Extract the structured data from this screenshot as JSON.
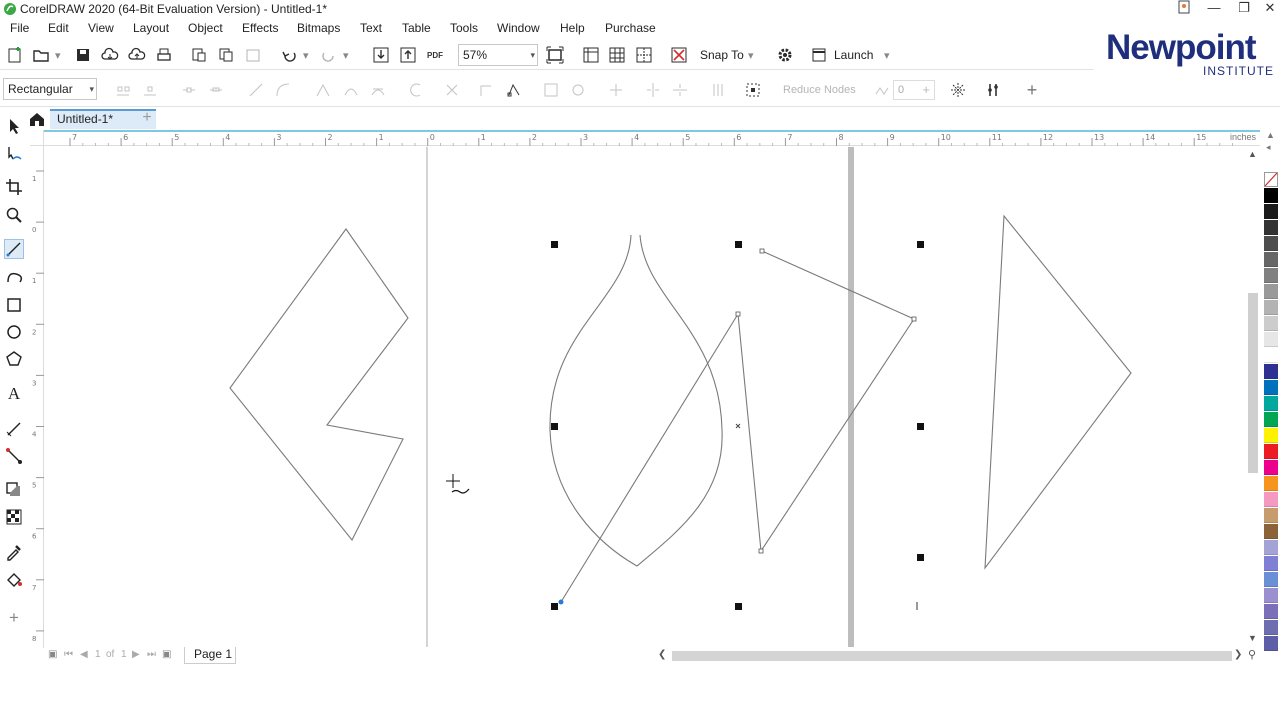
{
  "window": {
    "title": "CorelDRAW 2020 (64-Bit Evaluation Version) - Untitled-1*"
  },
  "menu": [
    "File",
    "Edit",
    "View",
    "Layout",
    "Object",
    "Effects",
    "Bitmaps",
    "Text",
    "Table",
    "Tools",
    "Window",
    "Help",
    "Purchase"
  ],
  "toolbar": {
    "zoom_value": "57%",
    "snap_to_label": "Snap To",
    "launch_label": "Launch",
    "pdf_label": "PDF"
  },
  "property_bar": {
    "selection_mode": "Rectangular",
    "reduce_nodes_label": "Reduce Nodes",
    "smoothness_value": "0"
  },
  "document_tab": {
    "label": "Untitled-1*"
  },
  "ruler": {
    "units": "inches",
    "h_ticks": [
      "7",
      "6",
      "5",
      "4",
      "3",
      "2",
      "1",
      "0",
      "1",
      "2",
      "3",
      "4",
      "5",
      "6",
      "7",
      "8",
      "9",
      "10",
      "11",
      "12",
      "13",
      "14",
      "15"
    ],
    "v_ticks": [
      "1",
      "0",
      "1",
      "2",
      "3",
      "4",
      "5",
      "6",
      "7",
      "8"
    ]
  },
  "page_nav": {
    "current": "1",
    "of_label": "of",
    "total": "1",
    "page_tab": "Page 1"
  },
  "palette_colors": [
    "#ffffff",
    "#000000",
    "#1a1a1a",
    "#333333",
    "#4d4d4d",
    "#666666",
    "#808080",
    "#999999",
    "#b3b3b3",
    "#cccccc",
    "#e6e6e6",
    "#ffffff",
    "#2e3192",
    "#0071bc",
    "#00a99d",
    "#00a651",
    "#fff200",
    "#ed1c24",
    "#ec008c",
    "#f7941d",
    "#f49ac1",
    "#c69c6d",
    "#8c6239",
    "#a3a3d6",
    "#7f7fd5",
    "#6b8fd6",
    "#9b8fd0",
    "#7a6fb8",
    "#6d6db0",
    "#5d5da8"
  ],
  "logo": {
    "main": "Newpoint",
    "sub": "INSTITUTE"
  }
}
